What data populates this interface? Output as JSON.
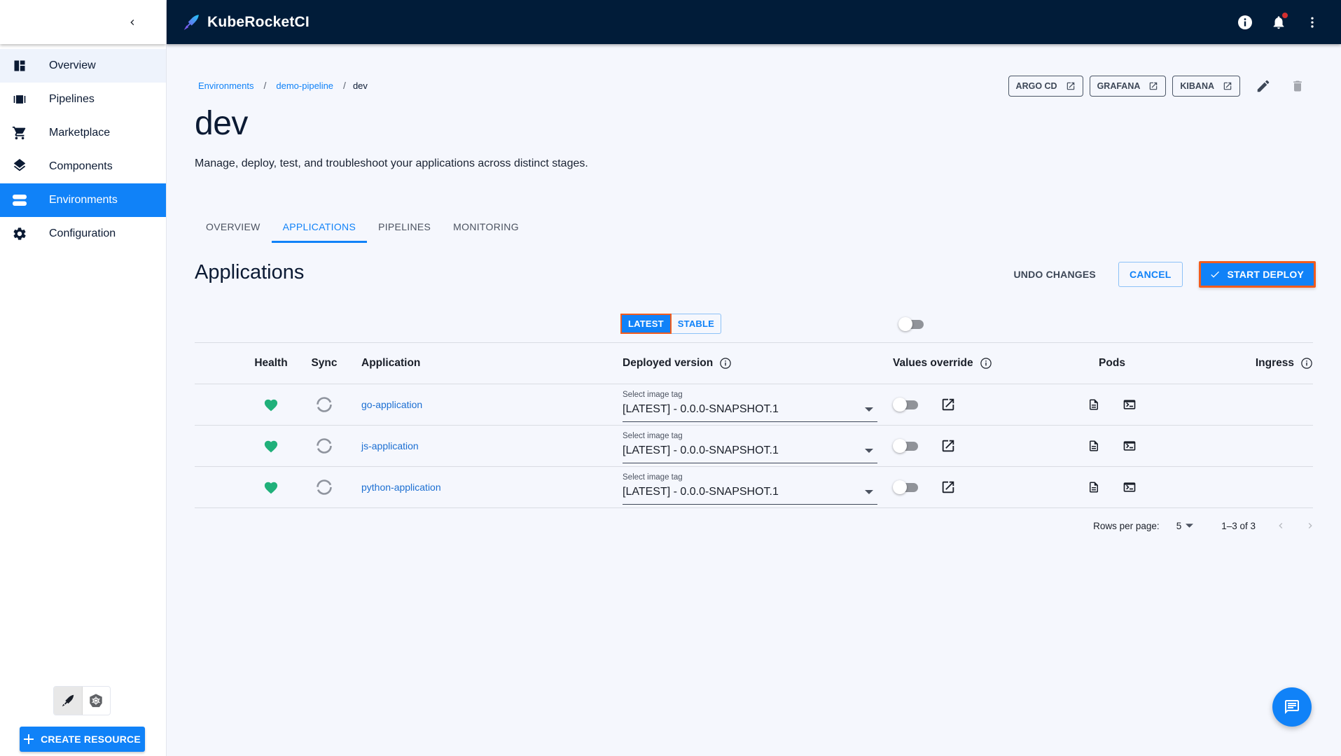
{
  "app": {
    "brand": "KubeRocketCI",
    "notification_indicator": true
  },
  "sidebar": {
    "items": [
      {
        "label": "Overview",
        "icon": "dashboard-icon",
        "state": "hover"
      },
      {
        "label": "Pipelines",
        "icon": "pipelines-icon",
        "state": ""
      },
      {
        "label": "Marketplace",
        "icon": "cart-icon",
        "state": ""
      },
      {
        "label": "Components",
        "icon": "layers-icon",
        "state": ""
      },
      {
        "label": "Environments",
        "icon": "environments-icon",
        "state": "active"
      },
      {
        "label": "Configuration",
        "icon": "gear-icon",
        "state": ""
      }
    ],
    "mode_options": [
      {
        "name": "krci-mode",
        "selected": true
      },
      {
        "name": "kubernetes-mode",
        "selected": false
      }
    ],
    "create_resource_label": "CREATE RESOURCE"
  },
  "breadcrumb": {
    "items": [
      {
        "label": "Environments",
        "link": true
      },
      {
        "label": "demo-pipeline",
        "link": true
      },
      {
        "label": "dev",
        "link": false
      }
    ],
    "separator": "/"
  },
  "page": {
    "title": "dev",
    "description": "Manage, deploy, test, and troubleshoot your applications across distinct stages."
  },
  "header_links": [
    {
      "label": "ARGO CD"
    },
    {
      "label": "GRAFANA"
    },
    {
      "label": "KIBANA"
    }
  ],
  "tabs": [
    {
      "label": "OVERVIEW",
      "active": false
    },
    {
      "label": "APPLICATIONS",
      "active": true
    },
    {
      "label": "PIPELINES",
      "active": false
    },
    {
      "label": "MONITORING",
      "active": false
    }
  ],
  "applications": {
    "title": "Applications",
    "undo_label": "UNDO CHANGES",
    "cancel_label": "CANCEL",
    "start_deploy_label": "START DEPLOY",
    "version_switch": {
      "options": [
        "LATEST",
        "STABLE"
      ],
      "selected": "LATEST"
    },
    "global_values_override": false,
    "columns": [
      "Health",
      "Sync",
      "Application",
      "Deployed version",
      "Values override",
      "Pods",
      "Ingress"
    ],
    "rows": [
      {
        "health": "healthy",
        "sync": "unknown",
        "application": "go-application",
        "image_tag_label": "Select image tag",
        "image_tag": "[LATEST] - 0.0.0-SNAPSHOT.1",
        "values_override": false
      },
      {
        "health": "healthy",
        "sync": "unknown",
        "application": "js-application",
        "image_tag_label": "Select image tag",
        "image_tag": "[LATEST] - 0.0.0-SNAPSHOT.1",
        "values_override": false
      },
      {
        "health": "healthy",
        "sync": "unknown",
        "application": "python-application",
        "image_tag_label": "Select image tag",
        "image_tag": "[LATEST] - 0.0.0-SNAPSHOT.1",
        "values_override": false
      }
    ],
    "pagination": {
      "rows_per_page_label": "Rows per page:",
      "rows_per_page": "5",
      "range": "1–3 of 3"
    }
  },
  "colors": {
    "primary": "#1082f8",
    "appbar": "#011c39",
    "highlight_outline": "#f25c1d",
    "health_ok": "#20b07a",
    "notification": "#d32f2f"
  }
}
